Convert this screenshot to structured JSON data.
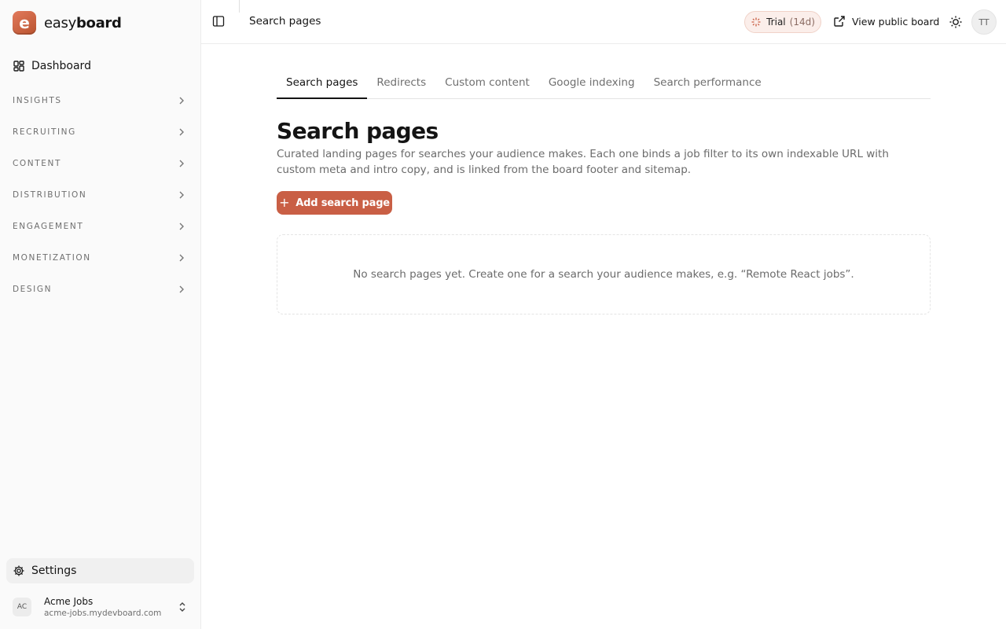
{
  "brand": {
    "name_light": "easy",
    "name_bold": "board",
    "logo_letter": "e"
  },
  "sidebar": {
    "dashboard_label": "Dashboard",
    "groups": [
      {
        "label": "INSIGHTS"
      },
      {
        "label": "RECRUITING"
      },
      {
        "label": "CONTENT"
      },
      {
        "label": "DISTRIBUTION"
      },
      {
        "label": "ENGAGEMENT"
      },
      {
        "label": "MONETIZATION"
      },
      {
        "label": "DESIGN"
      }
    ],
    "settings_label": "Settings",
    "account": {
      "initials": "AC",
      "name": "Acme Jobs",
      "domain": "acme-jobs.mydevboard.com"
    }
  },
  "topbar": {
    "title": "Search pages",
    "trial_label": "Trial",
    "trial_days": "(14d)",
    "view_public_label": "View public board",
    "user_initials": "TT"
  },
  "tabs": [
    {
      "label": "Search pages",
      "active": true
    },
    {
      "label": "Redirects",
      "active": false
    },
    {
      "label": "Custom content",
      "active": false
    },
    {
      "label": "Google indexing",
      "active": false
    },
    {
      "label": "Search performance",
      "active": false
    }
  ],
  "main": {
    "title": "Search pages",
    "description": "Curated landing pages for searches your audience makes. Each one binds a job filter to its own indexable URL with custom meta and intro copy, and is linked from the board footer and sitemap.",
    "add_button_label": "Add search page",
    "empty_state": "No search pages yet. Create one for a search your audience makes, e.g. “Remote React jobs”."
  },
  "colors": {
    "accent": "#c95f45",
    "trial_bg": "#fbeeea",
    "sidebar_bg": "#fafafa"
  }
}
